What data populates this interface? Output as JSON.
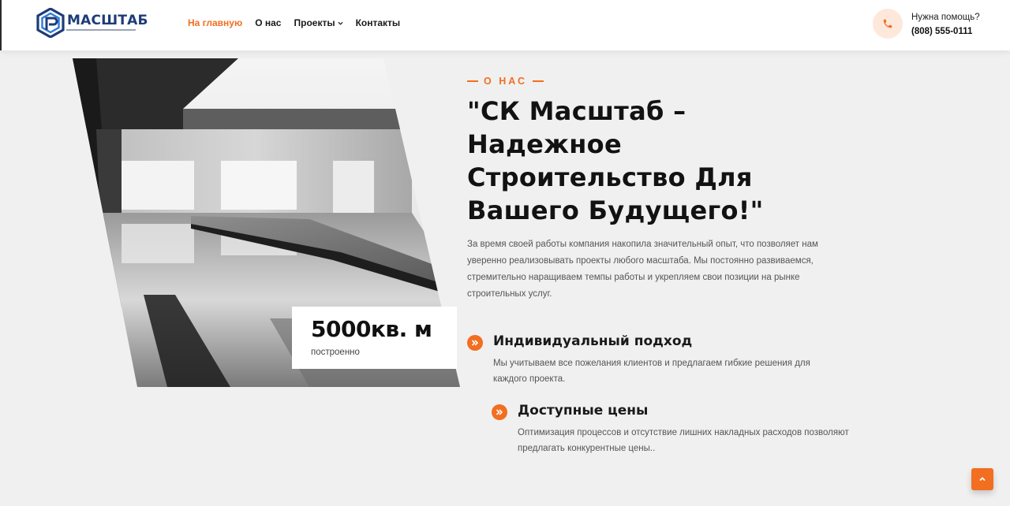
{
  "brand": {
    "name": "МАСШТАБ",
    "accent": "#f26e21",
    "logo_color": "#1d3c78"
  },
  "nav": {
    "items": [
      {
        "label": "На главную",
        "active": true
      },
      {
        "label": "О нас",
        "active": false
      },
      {
        "label": "Проекты",
        "active": false,
        "has_dropdown": true
      },
      {
        "label": "Контакты",
        "active": false
      }
    ]
  },
  "help": {
    "icon": "phone-icon",
    "label": "Нужна помощь?",
    "phone": "(808) 555-0111"
  },
  "stat": {
    "value": "5000кв. м",
    "label": "построенно"
  },
  "about": {
    "eyebrow": "О НАС",
    "title": "\"СК Масштаб – Надежное Строительство Для Вашего Будущего!\"",
    "description": "За время своей работы компания накопила значительный опыт, что позволяет нам уверенно реализовывать проекты любого масштаба. Мы постоянно развиваемся, стремительно наращиваем темпы работы и укрепляем свои позиции на рынке строительных услуг."
  },
  "features": [
    {
      "icon": "double-chevron-right-icon",
      "title": "Индивидуальный подход",
      "text": "Мы учитываем все пожелания клиентов и предлагаем гибкие решения для каждого проекта."
    },
    {
      "icon": "double-chevron-right-icon",
      "title": "Доступные цены",
      "text": "Оптимизация процессов и отсутствие лишних накладных расходов позволяют предлагать конкурентные цены.."
    }
  ],
  "scroll_top": {
    "icon": "chevron-up-icon"
  }
}
